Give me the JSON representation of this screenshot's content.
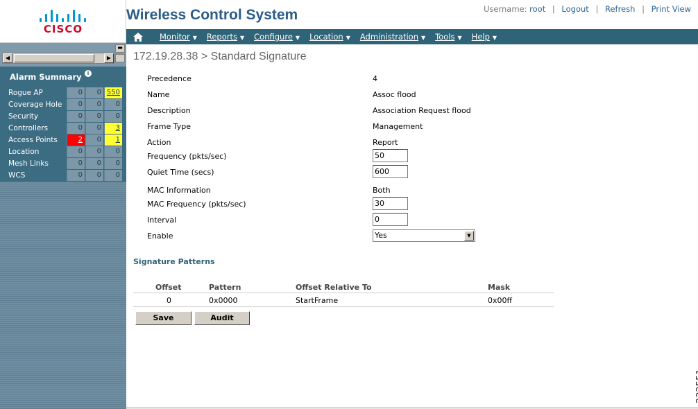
{
  "brand": {
    "logo_text": "CISCO",
    "app_title": "Wireless Control System"
  },
  "user_bar": {
    "username_label": "Username:",
    "username": "root",
    "logout": "Logout",
    "refresh": "Refresh",
    "print_view": "Print View"
  },
  "nav": {
    "items": [
      {
        "label": "Monitor"
      },
      {
        "label": "Reports"
      },
      {
        "label": "Configure"
      },
      {
        "label": "Location"
      },
      {
        "label": "Administration"
      },
      {
        "label": "Tools"
      },
      {
        "label": "Help"
      }
    ]
  },
  "alarm_summary": {
    "title": "Alarm Summary",
    "rows": [
      {
        "label": "Rogue AP",
        "critical": "0",
        "major": "0",
        "minor": "550"
      },
      {
        "label": "Coverage Hole",
        "critical": "0",
        "major": "0",
        "minor": "0"
      },
      {
        "label": "Security",
        "critical": "0",
        "major": "0",
        "minor": "0"
      },
      {
        "label": "Controllers",
        "critical": "0",
        "major": "0",
        "minor": "3"
      },
      {
        "label": "Access Points",
        "critical": "2",
        "major": "0",
        "minor": "1"
      },
      {
        "label": "Location",
        "critical": "0",
        "major": "0",
        "minor": "0"
      },
      {
        "label": "Mesh Links",
        "critical": "0",
        "major": "0",
        "minor": "0"
      },
      {
        "label": "WCS",
        "critical": "0",
        "major": "0",
        "minor": "0"
      }
    ]
  },
  "page": {
    "title": "172.19.28.38 > Standard  Signature"
  },
  "form": {
    "precedence": {
      "label": "Precedence",
      "value": "4"
    },
    "name": {
      "label": "Name",
      "value": "Assoc flood"
    },
    "description": {
      "label": "Description",
      "value": "Association Request flood"
    },
    "frame_type": {
      "label": "Frame Type",
      "value": "Management"
    },
    "action": {
      "label": "Action",
      "value": "Report"
    },
    "frequency": {
      "label": "Frequency (pkts/sec)",
      "value": "50"
    },
    "quiet_time": {
      "label": "Quiet Time (secs)",
      "value": "600"
    },
    "mac_information": {
      "label": "MAC Information",
      "value": "Both"
    },
    "mac_frequency": {
      "label": "MAC Frequency (pkts/sec)",
      "value": "30"
    },
    "interval": {
      "label": "Interval",
      "value": "0"
    },
    "enable": {
      "label": "Enable",
      "value": "Yes"
    }
  },
  "patterns": {
    "heading": "Signature  Patterns",
    "columns": [
      "Offset",
      "Pattern",
      "Offset Relative To",
      "Mask"
    ],
    "rows": [
      {
        "offset": "0",
        "pattern": "0x0000",
        "relative_to": "StartFrame",
        "mask": "0x00ff"
      }
    ]
  },
  "buttons": {
    "save": "Save",
    "audit": "Audit"
  },
  "figure_id": "232551",
  "colors": {
    "nav_bg": "#2e6378",
    "alarm_bg": "#3c6c82",
    "title_blue": "#2b5c8a",
    "cisco_red": "#cc092f",
    "minor_yellow": "#ffff33",
    "critical_red": "#ff0000"
  }
}
